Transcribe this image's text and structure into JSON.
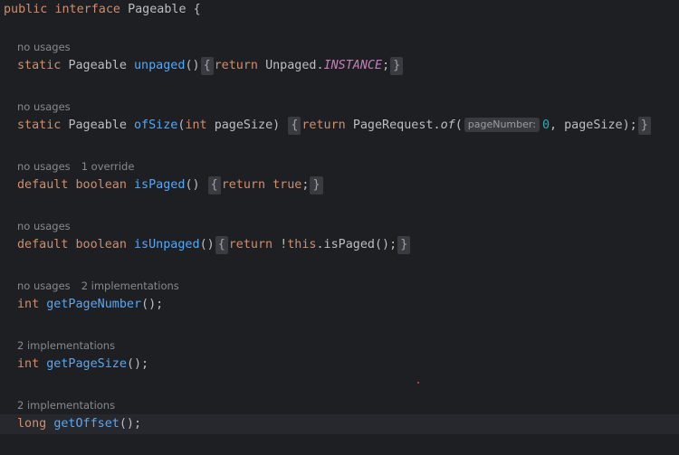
{
  "interface": {
    "kw_public": "public",
    "kw_interface": "interface",
    "name": "Pageable",
    "brace": "{"
  },
  "members": [
    {
      "hint": "no usages",
      "code": {
        "kw1": "static",
        "type": "Pageable",
        "method": "unpaged",
        "params": "()",
        "fold_open": "{",
        "kw_return": "return",
        "expr_a": "Unpaged.",
        "expr_field": "INSTANCE",
        "semi": ";",
        "fold_close": "}"
      }
    },
    {
      "hint": "no usages",
      "code": {
        "kw1": "static",
        "type": "Pageable",
        "method": "ofSize",
        "paren_open": "(",
        "param_type": "int",
        "param_name": "pageSize)",
        "fold_open": "{",
        "kw_return": "return",
        "call_obj": "PageRequest.",
        "call_method": "of",
        "call_open": "(",
        "param_hint": "pageNumber:",
        "num": "0",
        "rest": ", pageSize);",
        "fold_close": "}"
      }
    },
    {
      "hint": "no usages",
      "hint2": "1 override",
      "code": {
        "kw1": "default",
        "kw2": "boolean",
        "method": "isPaged",
        "params": "()",
        "fold_open": "{",
        "kw_return": "return",
        "kw_true": "true",
        "semi": ";",
        "fold_close": "}"
      }
    },
    {
      "hint": "no usages",
      "code": {
        "kw1": "default",
        "kw2": "boolean",
        "method": "isUnpaged",
        "params": "()",
        "fold_open": "{",
        "kw_return": "return",
        "bang": "!",
        "kw_this": "this",
        "rest": ".isPaged();",
        "fold_close": "}"
      }
    },
    {
      "hint": "no usages",
      "hint2": "2 implementations",
      "code": {
        "kw1": "int",
        "method": "getPageNumber",
        "rest": "();"
      }
    },
    {
      "hint": "2 implementations",
      "code": {
        "kw1": "int",
        "method": "getPageSize",
        "rest": "();"
      }
    },
    {
      "hint": "2 implementations",
      "code": {
        "kw1": "long",
        "method": "getOffset",
        "rest": "();"
      }
    }
  ],
  "colors": {
    "background": "#1e1f22",
    "keyword": "#cf8e6d",
    "method": "#56a8f5",
    "static_field": "#c77dbb",
    "number": "#2aacb8",
    "hint_text": "#86898f",
    "error_marker": "#e84b4b"
  }
}
